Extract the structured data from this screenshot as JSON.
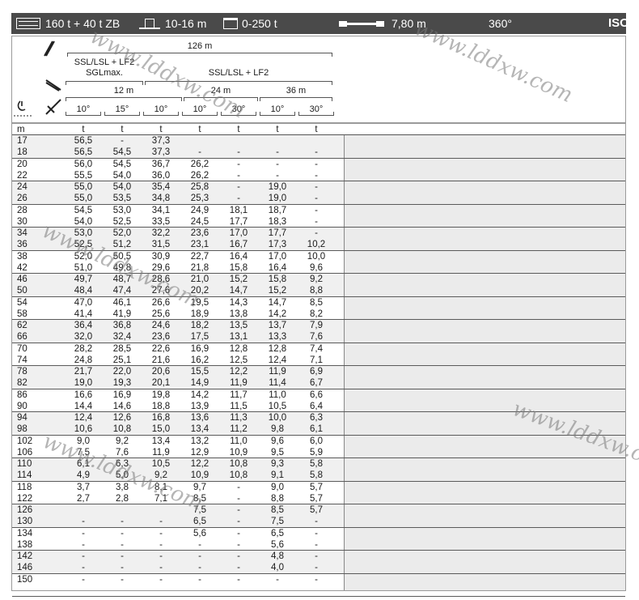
{
  "top_bar": {
    "counterweight": "160 t + 40 t ZB",
    "ballast_radius": "10-16 m",
    "ballast_weight": "0-250 t",
    "outrigger_base": "7,80 m",
    "slewing_range": "360°",
    "norm": "ISO"
  },
  "header": {
    "main_boom_length": "126 m",
    "configuration_left_line1": "SSL/LSL + LF2",
    "configuration_left_line2": "SGLmax.",
    "configuration_right": "SSL/LSL + LF2",
    "jib_12": "12 m",
    "jib_24": "24 m",
    "jib_36": "36 m",
    "angles": [
      "10°",
      "15°",
      "10°",
      "10°",
      "30°",
      "10°",
      "30°"
    ]
  },
  "table": {
    "unit_header": [
      "m",
      "t",
      "t",
      "t",
      "t",
      "t",
      "t",
      "t"
    ],
    "rows": [
      [
        "17",
        "56,5",
        "-",
        "37,3",
        "",
        "",
        "",
        ""
      ],
      [
        "18",
        "56,5",
        "54,5",
        "37,3",
        "-",
        "-",
        "-",
        "-"
      ],
      [
        "20",
        "56,0",
        "54,5",
        "36,7",
        "26,2",
        "-",
        "-",
        "-"
      ],
      [
        "22",
        "55,5",
        "54,0",
        "36,0",
        "26,2",
        "-",
        "-",
        "-"
      ],
      [
        "24",
        "55,0",
        "54,0",
        "35,4",
        "25,8",
        "-",
        "19,0",
        "-"
      ],
      [
        "26",
        "55,0",
        "53,5",
        "34,8",
        "25,3",
        "-",
        "19,0",
        "-"
      ],
      [
        "28",
        "54,5",
        "53,0",
        "34,1",
        "24,9",
        "18,1",
        "18,7",
        "-"
      ],
      [
        "30",
        "54,0",
        "52,5",
        "33,5",
        "24,5",
        "17,7",
        "18,3",
        "-"
      ],
      [
        "34",
        "53,0",
        "52,0",
        "32,2",
        "23,6",
        "17,0",
        "17,7",
        "-"
      ],
      [
        "36",
        "52,5",
        "51,2",
        "31,5",
        "23,1",
        "16,7",
        "17,3",
        "10,2"
      ],
      [
        "38",
        "52,0",
        "50,5",
        "30,9",
        "22,7",
        "16,4",
        "17,0",
        "10,0"
      ],
      [
        "42",
        "51,0",
        "49,8",
        "29,6",
        "21,8",
        "15,8",
        "16,4",
        "9,6"
      ],
      [
        "46",
        "49,7",
        "48,7",
        "28,6",
        "21,0",
        "15,2",
        "15,8",
        "9,2"
      ],
      [
        "50",
        "48,4",
        "47,4",
        "27,6",
        "20,2",
        "14,7",
        "15,2",
        "8,8"
      ],
      [
        "54",
        "47,0",
        "46,1",
        "26,6",
        "19,5",
        "14,3",
        "14,7",
        "8,5"
      ],
      [
        "58",
        "41,4",
        "41,9",
        "25,6",
        "18,9",
        "13,8",
        "14,2",
        "8,2"
      ],
      [
        "62",
        "36,4",
        "36,8",
        "24,6",
        "18,2",
        "13,5",
        "13,7",
        "7,9"
      ],
      [
        "66",
        "32,0",
        "32,4",
        "23,6",
        "17,5",
        "13,1",
        "13,3",
        "7,6"
      ],
      [
        "70",
        "28,2",
        "28,5",
        "22,6",
        "16,9",
        "12,8",
        "12,8",
        "7,4"
      ],
      [
        "74",
        "24,8",
        "25,1",
        "21,6",
        "16,2",
        "12,5",
        "12,4",
        "7,1"
      ],
      [
        "78",
        "21,7",
        "22,0",
        "20,6",
        "15,5",
        "12,2",
        "11,9",
        "6,9"
      ],
      [
        "82",
        "19,0",
        "19,3",
        "20,1",
        "14,9",
        "11,9",
        "11,4",
        "6,7"
      ],
      [
        "86",
        "16,6",
        "16,9",
        "19,8",
        "14,2",
        "11,7",
        "11,0",
        "6,6"
      ],
      [
        "90",
        "14,4",
        "14,6",
        "18,8",
        "13,9",
        "11,5",
        "10,5",
        "6,4"
      ],
      [
        "94",
        "12,4",
        "12,6",
        "16,8",
        "13,6",
        "11,3",
        "10,0",
        "6,3"
      ],
      [
        "98",
        "10,6",
        "10,8",
        "15,0",
        "13,4",
        "11,2",
        "9,8",
        "6,1"
      ],
      [
        "102",
        "9,0",
        "9,2",
        "13,4",
        "13,2",
        "11,0",
        "9,6",
        "6,0"
      ],
      [
        "106",
        "7,5",
        "7,6",
        "11,9",
        "12,9",
        "10,9",
        "9,5",
        "5,9"
      ],
      [
        "110",
        "6,1",
        "6,3",
        "10,5",
        "12,2",
        "10,8",
        "9,3",
        "5,8"
      ],
      [
        "114",
        "4,9",
        "5,0",
        "9,2",
        "10,9",
        "10,8",
        "9,1",
        "5,8"
      ],
      [
        "118",
        "3,7",
        "3,8",
        "8,1",
        "9,7",
        "-",
        "9,0",
        "5,7"
      ],
      [
        "122",
        "2,7",
        "2,8",
        "7,1",
        "8,5",
        "-",
        "8,8",
        "5,7"
      ],
      [
        "126",
        "",
        "",
        "",
        "7,5",
        "-",
        "8,5",
        "5,7"
      ],
      [
        "130",
        "-",
        "-",
        "-",
        "6,5",
        "-",
        "7,5",
        "-"
      ],
      [
        "134",
        "-",
        "-",
        "-",
        "5,6",
        "-",
        "6,5",
        "-"
      ],
      [
        "138",
        "-",
        "-",
        "-",
        "-",
        "-",
        "5,6",
        "-"
      ],
      [
        "142",
        "-",
        "-",
        "-",
        "-",
        "-",
        "4,8",
        "-"
      ],
      [
        "146",
        "-",
        "-",
        "-",
        "-",
        "-",
        "4,0",
        "-"
      ],
      [
        "150",
        "-",
        "-",
        "-",
        "-",
        "-",
        "-",
        "-"
      ]
    ]
  },
  "watermark": "www.lddxw.com"
}
